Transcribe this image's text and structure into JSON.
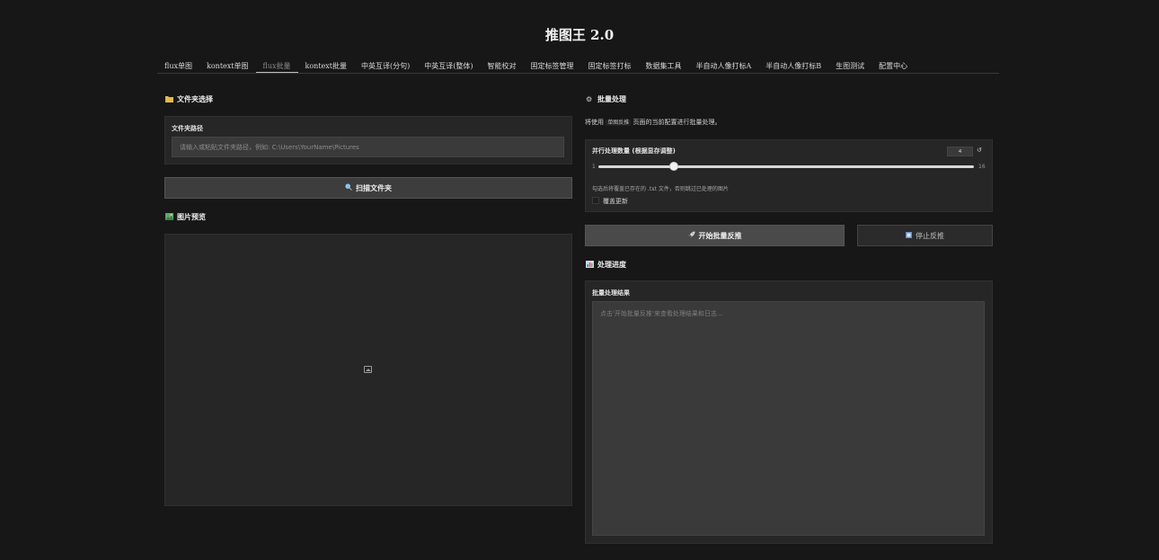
{
  "app": {
    "title": "推图王 2.0"
  },
  "tabs": [
    {
      "label": "flux单图"
    },
    {
      "label": "kontext单图"
    },
    {
      "label": "flux批量",
      "active": true
    },
    {
      "label": "kontext批量"
    },
    {
      "label": "中英互译(分句)"
    },
    {
      "label": "中英互译(整体)"
    },
    {
      "label": "智能校对"
    },
    {
      "label": "固定标签管理"
    },
    {
      "label": "固定标签打标"
    },
    {
      "label": "数据集工具"
    },
    {
      "label": "半自动人像打标A"
    },
    {
      "label": "半自动人像打标B"
    },
    {
      "label": "生图测试"
    },
    {
      "label": "配置中心"
    }
  ],
  "left": {
    "folder_section": {
      "icon": "folder-icon",
      "title": "文件夹选择"
    },
    "folder_path": {
      "label": "文件夹路径",
      "value": "",
      "placeholder": "请输入或粘贴文件夹路径，例如: C:\\Users\\YourName\\Pictures"
    },
    "scan_button": {
      "icon": "magnifier-icon",
      "label": "扫描文件夹"
    },
    "preview_section": {
      "icon": "picture-icon",
      "title": "图片预览"
    }
  },
  "right": {
    "batch_section": {
      "icon": "gear-icon",
      "title": "批量处理"
    },
    "description": {
      "prefix": "将使用",
      "code": "单图反推",
      "suffix": "页面的当前配置进行批量处理。"
    },
    "concurrency": {
      "label": "并行处理数量 (根据显存调整)",
      "value": 4,
      "min": 1,
      "max": 16,
      "min_label": "1",
      "max_label": "16",
      "reset_icon": "↺"
    },
    "overwrite": {
      "hint": "勾选后将覆盖已存在的 .txt 文件，否则跳过已处理的图片",
      "label": "覆盖更新",
      "checked": false
    },
    "start_button": {
      "icon": "rocket-icon",
      "label": "开始批量反推"
    },
    "stop_button": {
      "icon": "stop-icon",
      "label": "停止反推"
    },
    "progress_section": {
      "icon": "bar-chart-icon",
      "title": "处理进度"
    },
    "result": {
      "label": "批量处理结果",
      "value": "",
      "placeholder": "点击'开始批量反推'来查看处理结果和日志..."
    }
  },
  "colors": {
    "background": "#171717",
    "panel": "#262626",
    "accent": "#4a4a4a"
  }
}
